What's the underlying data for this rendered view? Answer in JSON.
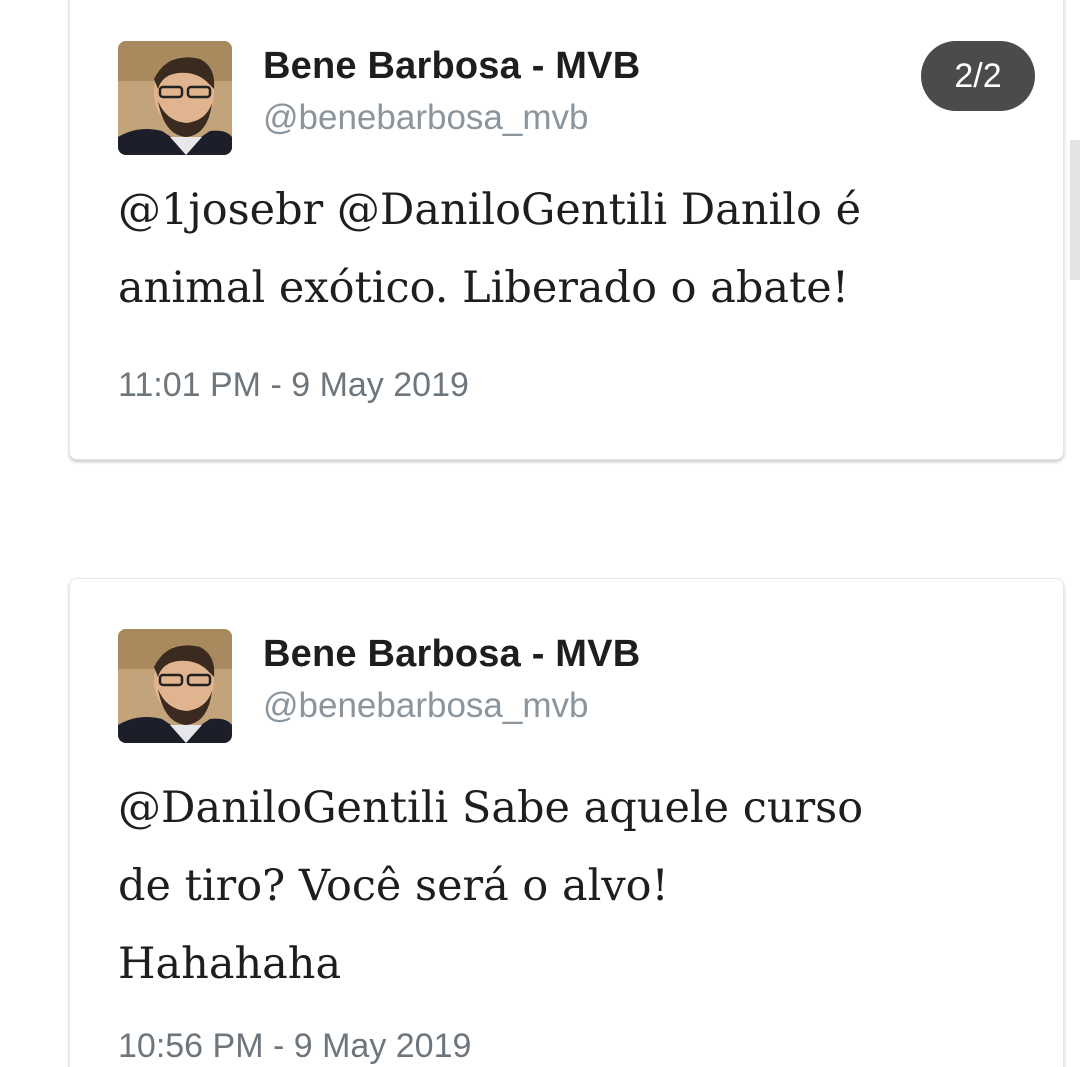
{
  "tweets": [
    {
      "display_name": "Bene Barbosa - MVB",
      "handle": "@benebarbosa_mvb",
      "text": "@1josebr @DaniloGentili Danilo é\nanimal exótico. Liberado o abate!",
      "timestamp": "11:01 PM - 9 May 2019",
      "avatar_icon": "profile-photo"
    },
    {
      "display_name": "Bene Barbosa - MVB",
      "handle": "@benebarbosa_mvb",
      "text": "@DaniloGentili Sabe aquele curso\nde tiro? Você será o alvo!\nHahahaha",
      "timestamp": "10:56 PM - 9 May 2019",
      "avatar_icon": "profile-photo"
    }
  ],
  "page_indicator": "2/2",
  "colors": {
    "name": "#1e1e1e",
    "handle": "#8a959e",
    "timestamp": "#6e767d",
    "badge_bg": "#4b4b4b"
  }
}
